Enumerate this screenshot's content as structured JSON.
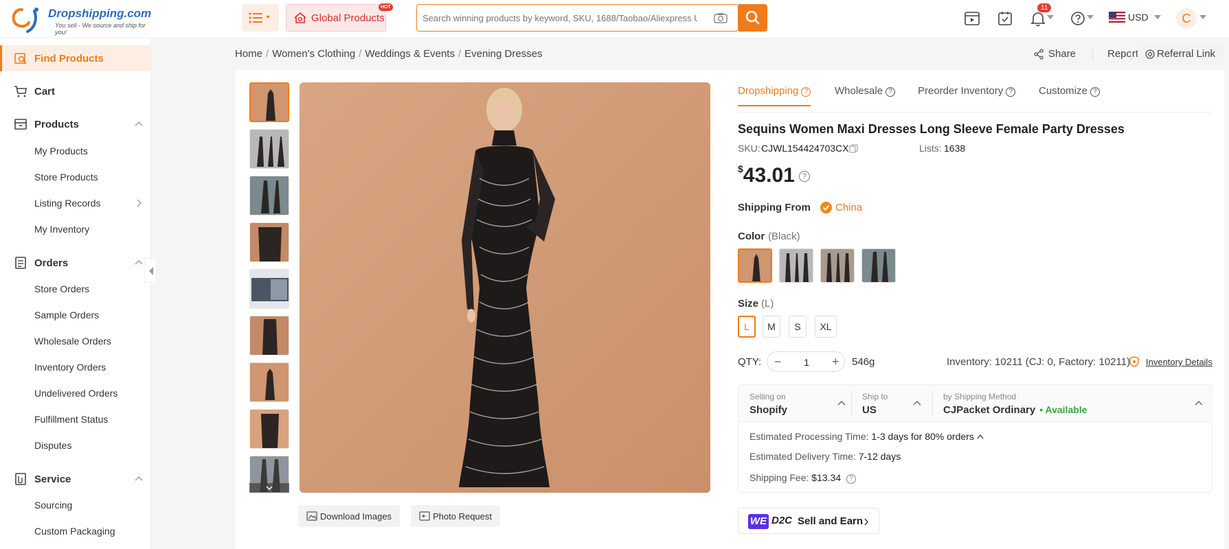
{
  "header": {
    "brand": "Dropshipping.com",
    "tagline": "You sell - We source and ship for you!",
    "global_products": "Global Products",
    "hot_badge": "HOT",
    "search_placeholder": "Search winning products by keyword, SKU, 1688/Taobao/Aliexpress URL",
    "notification_count": "11",
    "currency": "USD",
    "avatar_letter": "C",
    "accent_color": "#f07b1a"
  },
  "sidebar": {
    "find_products": "Find Products",
    "cart": "Cart",
    "products": "Products",
    "products_items": [
      "My Products",
      "Store Products",
      "Listing Records",
      "My Inventory"
    ],
    "orders": "Orders",
    "orders_items": [
      "Store Orders",
      "Sample Orders",
      "Wholesale Orders",
      "Inventory Orders",
      "Undelivered Orders",
      "Fulfillment Status",
      "Disputes"
    ],
    "service": "Service",
    "service_items": [
      "Sourcing",
      "Custom Packaging"
    ]
  },
  "breadcrumb": [
    "Home",
    "Women's Clothing",
    "Weddings & Events",
    "Evening Dresses"
  ],
  "actions": {
    "share": "Share",
    "report": "Report",
    "referral": "Referral Link"
  },
  "gallery": {
    "download_images": "Download Images",
    "photo_request": "Photo Request"
  },
  "product": {
    "tabs": [
      "Dropshipping",
      "Wholesale",
      "Preorder Inventory",
      "Customize"
    ],
    "active_tab": "Dropshipping",
    "title": "Sequins Women Maxi Dresses Long Sleeve Female Party Dresses",
    "sku_label": "SKU:",
    "sku": "CJWL154424703CX",
    "lists_label": "Lists:",
    "lists": "1638",
    "currency_symbol": "$",
    "price": "43.01",
    "shipping_from_label": "Shipping From",
    "shipping_from": "China",
    "color_label": "Color",
    "color_value": "(Black)",
    "size_label": "Size",
    "size_value": "(L)",
    "sizes": [
      "L",
      "M",
      "S",
      "XL"
    ],
    "selected_size": "L",
    "qty_label": "QTY:",
    "qty": "1",
    "weight": "546g",
    "inventory": "Inventory: 10211  (CJ: 0, Factory: 10211)",
    "inventory_details": "Inventory Details"
  },
  "shipping": {
    "selling_on_label": "Selling on",
    "selling_on": "Shopify",
    "ship_to_label": "Ship to",
    "ship_to": "US",
    "method_label": "by Shipping Method",
    "method": "CJPacket Ordinary",
    "availability": "• Available",
    "processing_label": "Estimated Processing Time:",
    "processing": "1-3 days for 80% orders",
    "delivery_label": "Estimated Delivery Time:",
    "delivery": "7-12 days",
    "fee_label": "Shipping Fee:",
    "fee": "$13.34"
  },
  "d2c": {
    "we": "WE",
    "d2c": "D2C",
    "label": "Sell and Earn"
  }
}
